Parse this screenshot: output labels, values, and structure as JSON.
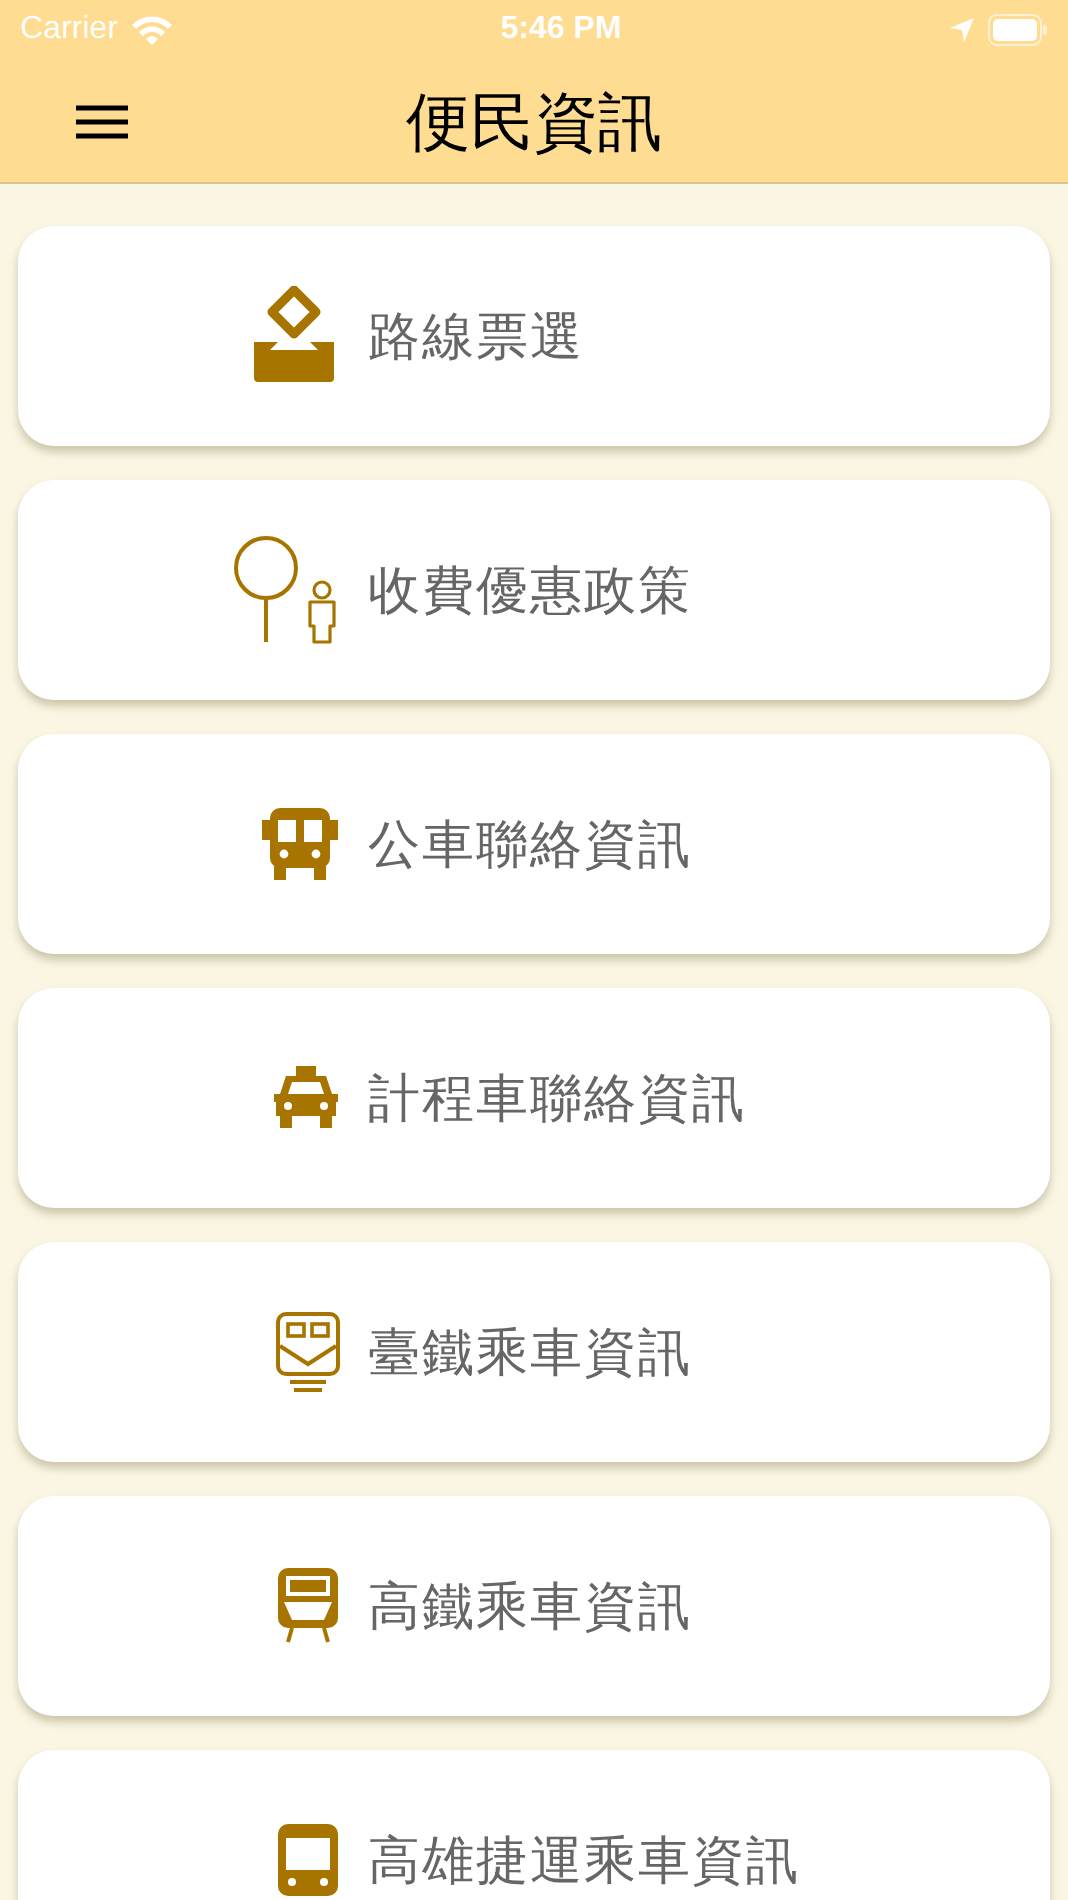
{
  "status_bar": {
    "carrier": "Carrier",
    "time": "5:46 PM"
  },
  "nav": {
    "title": "便民資訊"
  },
  "items": [
    {
      "kind": "ballot",
      "label": "路線票選"
    },
    {
      "kind": "fare",
      "label": "收費優惠政策"
    },
    {
      "kind": "bus",
      "label": "公車聯絡資訊"
    },
    {
      "kind": "taxi",
      "label": "計程車聯絡資訊"
    },
    {
      "kind": "train",
      "label": "臺鐵乘車資訊"
    },
    {
      "kind": "hsr",
      "label": "高鐵乘車資訊"
    },
    {
      "kind": "metro",
      "label": "高雄捷運乘車資訊"
    }
  ]
}
